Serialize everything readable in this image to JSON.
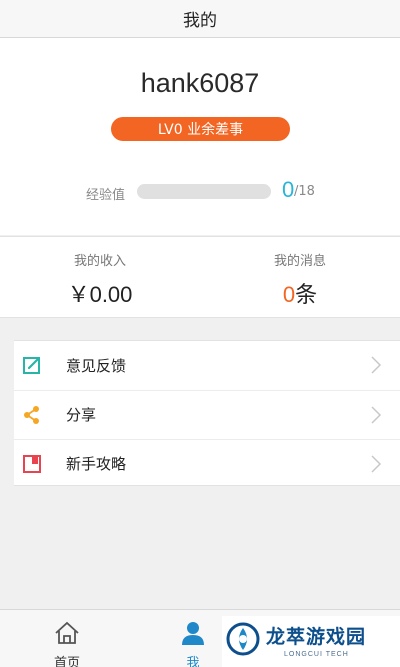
{
  "header": {
    "title": "我的"
  },
  "profile": {
    "username": "hank6087",
    "level_badge": "LV0 业余差事",
    "exp_label": "经验值",
    "exp_current": "0",
    "exp_max": "/18",
    "exp_progress": 0.0
  },
  "stats": {
    "income_label": "我的收入",
    "income_value": "￥0.00",
    "messages_label": "我的消息",
    "messages_count": "0",
    "messages_unit": "条"
  },
  "menu": {
    "items": [
      {
        "label": "意见反馈",
        "icon": "edit-icon",
        "color": "#26b5a7"
      },
      {
        "label": "分享",
        "icon": "share-icon",
        "color": "#f5a623"
      },
      {
        "label": "新手攻略",
        "icon": "bookmark-icon",
        "color": "#e8434f"
      }
    ]
  },
  "tabs": [
    {
      "label": "首页",
      "icon": "home-icon"
    },
    {
      "label": "我",
      "icon": "person-icon"
    }
  ],
  "watermark": {
    "title": "龙萃游戏园",
    "subtitle": "LONGCUI TECH"
  },
  "colors": {
    "accent": "#f26522",
    "exp": "#29b6d6",
    "active_tab": "#1e88c8"
  }
}
